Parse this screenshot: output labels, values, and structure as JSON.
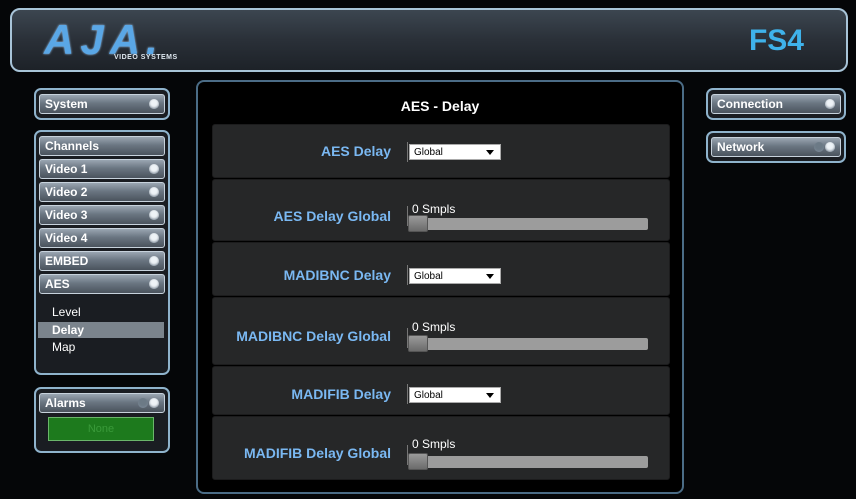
{
  "header": {
    "logo_text": "AJA.",
    "logo_sub": "VIDEO SYSTEMS",
    "model": "FS4"
  },
  "sidebar": {
    "system": "System",
    "channels": "Channels",
    "items": [
      "Video 1",
      "Video 2",
      "Video 3",
      "Video 4",
      "EMBED",
      "AES"
    ],
    "aes_sub": [
      "Level",
      "Delay",
      "Map"
    ],
    "alarms": "Alarms",
    "alarm_status": "None"
  },
  "right": {
    "connection": "Connection",
    "network": "Network"
  },
  "main": {
    "title": "AES - Delay",
    "rows": [
      {
        "label": "AES Delay",
        "type": "select",
        "value": "Global"
      },
      {
        "label": "AES Delay Global",
        "type": "slider",
        "value": "0 Smpls",
        "level": 0
      },
      {
        "label": "MADIBNC Delay",
        "type": "select",
        "value": "Global"
      },
      {
        "label": "MADIBNC Delay Global",
        "type": "slider",
        "value": "0 Smpls",
        "level": 0
      },
      {
        "label": "MADIFIB Delay",
        "type": "select",
        "value": "Global"
      },
      {
        "label": "MADIFIB Delay Global",
        "type": "slider",
        "value": "0 Smpls",
        "level": 0
      }
    ]
  },
  "colors": {
    "accent": "#3fb2ea",
    "label_blue": "#7ab8f2",
    "alarm_green": "#1d7a1d"
  }
}
